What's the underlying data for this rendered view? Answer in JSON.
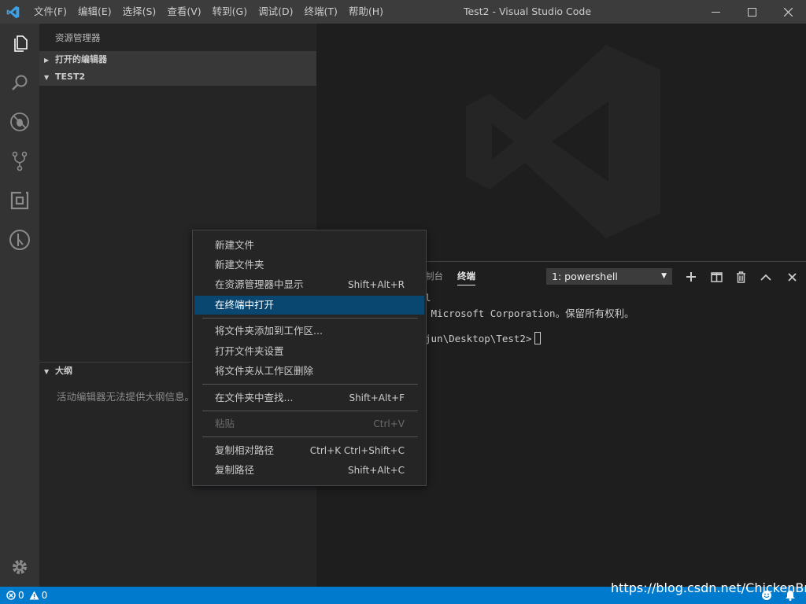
{
  "titlebar": {
    "menu": [
      "文件(F)",
      "编辑(E)",
      "选择(S)",
      "查看(V)",
      "转到(G)",
      "调试(D)",
      "终端(T)",
      "帮助(H)"
    ],
    "title": "Test2 - Visual Studio Code"
  },
  "activitybar": {
    "icons": [
      "files-icon",
      "search-icon",
      "debug-icon",
      "source-control-icon",
      "extensions-icon",
      "remote-icon",
      "settings-gear-icon"
    ]
  },
  "sidebar": {
    "title": "资源管理器",
    "open_editors": "打开的编辑器",
    "folder": "TEST2",
    "outline": "大纲",
    "outline_message": "活动编辑器无法提供大纲信息。"
  },
  "panel": {
    "tab_console_partial": "制台",
    "tab_terminal": "终端",
    "terminal_select": "1: powershell",
    "terminal_lines": [
      "l",
      " Microsoft Corporation。保留所有权利。",
      "",
      "jun\\Desktop\\Test2>"
    ]
  },
  "context_menu": {
    "items": [
      {
        "label": "新建文件",
        "shortcut": ""
      },
      {
        "label": "新建文件夹",
        "shortcut": ""
      },
      {
        "label": "在资源管理器中显示",
        "shortcut": "Shift+Alt+R"
      },
      {
        "label": "在终端中打开",
        "shortcut": ""
      },
      {
        "label": "将文件夹添加到工作区...",
        "shortcut": ""
      },
      {
        "label": "打开文件夹设置",
        "shortcut": ""
      },
      {
        "label": "将文件夹从工作区删除",
        "shortcut": ""
      },
      {
        "label": "在文件夹中查找...",
        "shortcut": "Shift+Alt+F"
      },
      {
        "label": "粘贴",
        "shortcut": "Ctrl+V"
      },
      {
        "label": "复制相对路径",
        "shortcut": "Ctrl+K Ctrl+Shift+C"
      },
      {
        "label": "复制路径",
        "shortcut": "Shift+Alt+C"
      }
    ],
    "selected_label": "在终端中打开",
    "disabled_label": "粘贴"
  },
  "statusbar": {
    "errors": "0",
    "warnings": "0",
    "watermark": "https://blog.csdn.net/ChickenBro_"
  },
  "colors": {
    "accent": "#007acc",
    "selection": "#094771",
    "activitybar": "#333333",
    "sidebar": "#252526",
    "editor": "#1e1e1e"
  }
}
